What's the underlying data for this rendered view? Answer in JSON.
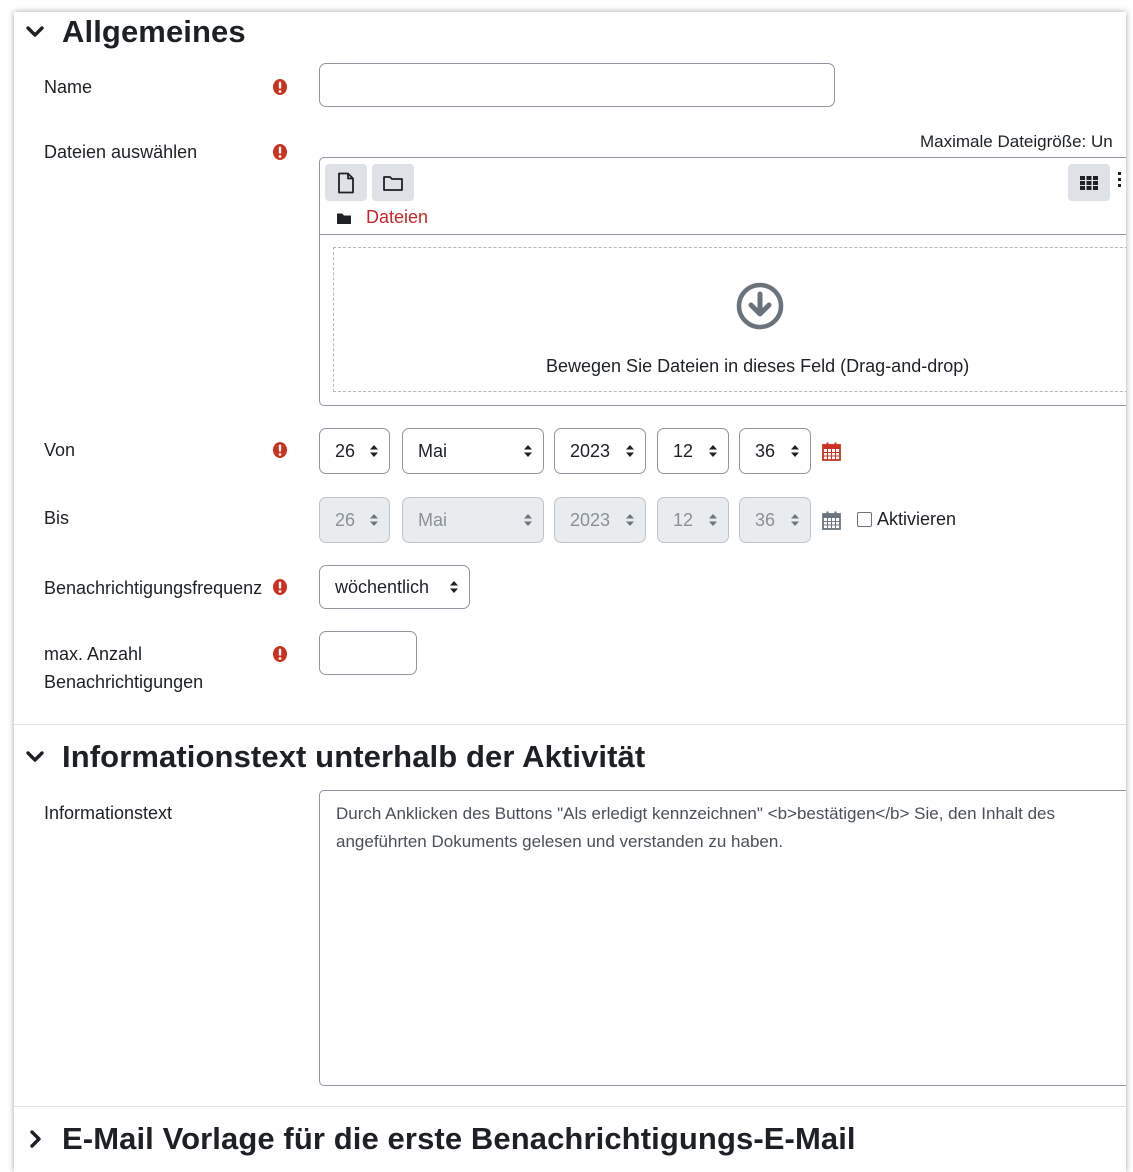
{
  "sections": {
    "general": {
      "title": "Allgemeines"
    },
    "info": {
      "title": "Informationstext unterhalb der Aktivität"
    },
    "email": {
      "title": "E-Mail Vorlage für die erste Benachrichtigungs-E-Mail"
    }
  },
  "fields": {
    "name": {
      "label": "Name",
      "value": ""
    },
    "files": {
      "label": "Dateien auswählen",
      "max_size": "Maximale Dateigröße: Un",
      "folder_label": "Dateien",
      "drop_hint": "Bewegen Sie Dateien in dieses Feld (Drag-and-drop)"
    },
    "from": {
      "label": "Von",
      "day": "26",
      "month": "Mai",
      "year": "2023",
      "hour": "12",
      "minute": "36"
    },
    "to": {
      "label": "Bis",
      "day": "26",
      "month": "Mai",
      "year": "2023",
      "hour": "12",
      "minute": "36",
      "enable_label": "Aktivieren",
      "enabled": false
    },
    "frequency": {
      "label": "Benachrichtigungsfrequenz",
      "value": "wöchentlich"
    },
    "max_count": {
      "label_line1": "max. Anzahl",
      "label_line2": "Benachrichtigungen",
      "value": ""
    },
    "infotext": {
      "label": "Informationstext",
      "value": "Durch Anklicken des Buttons \"Als erledigt kennzeichnen\" <b>bestätigen</b> Sie, den Inhalt des angeführten Dokuments gelesen und verstanden zu haben."
    }
  },
  "icons": {
    "required": "exclamation-circle-icon",
    "calendar": "calendar-icon",
    "chevron_down": "chevron-down-icon",
    "chevron_right": "chevron-right-icon",
    "add_file": "file-icon",
    "new_folder": "folder-icon",
    "grid_view": "grid-view-icon",
    "folder": "folder-icon",
    "download": "arrow-circle-down-icon"
  },
  "colors": {
    "required": "#ca3120",
    "link": "#c8272a",
    "calendar_active": "#ca3120"
  }
}
